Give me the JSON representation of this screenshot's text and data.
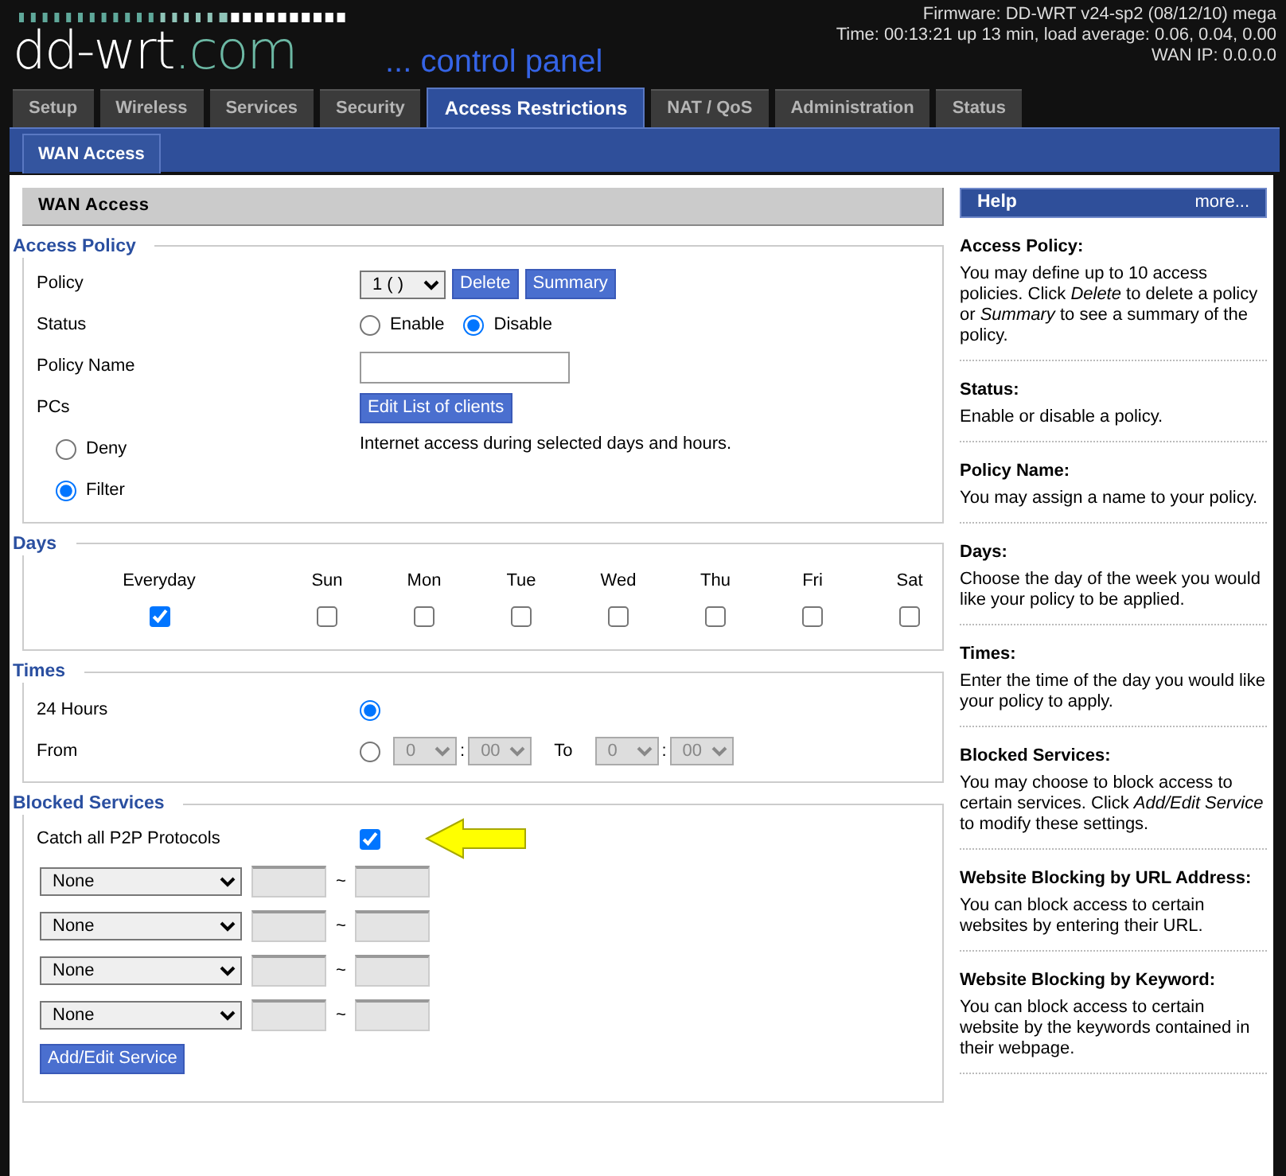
{
  "header": {
    "logo": {
      "main": "dd-wrt",
      "suffix": ".com"
    },
    "tagline": "... control panel",
    "info": [
      "Firmware: DD-WRT v24-sp2 (08/12/10) mega",
      "Time: 00:13:21 up 13 min, load average: 0.06, 0.04, 0.00",
      "WAN IP: 0.0.0.0"
    ]
  },
  "tabs": [
    {
      "label": "Setup",
      "selected": false
    },
    {
      "label": "Wireless",
      "selected": false
    },
    {
      "label": "Services",
      "selected": false
    },
    {
      "label": "Security",
      "selected": false
    },
    {
      "label": "Access Restrictions",
      "selected": true
    },
    {
      "label": "NAT / QoS",
      "selected": false
    },
    {
      "label": "Administration",
      "selected": false
    },
    {
      "label": "Status",
      "selected": false
    }
  ],
  "subtabs": [
    {
      "label": "WAN Access",
      "selected": true
    }
  ],
  "page_title": "WAN Access",
  "access_policy": {
    "legend": "Access Policy",
    "policy": {
      "label": "Policy",
      "value": "1 ( )",
      "buttons": [
        "Delete",
        "Summary"
      ]
    },
    "status": {
      "label": "Status",
      "options": [
        {
          "label": "Enable",
          "selected": false
        },
        {
          "label": "Disable",
          "selected": true
        }
      ]
    },
    "policy_name": {
      "label": "Policy Name"
    },
    "pcs": {
      "label": "PCs",
      "button": "Edit List of clients"
    },
    "modes": [
      {
        "label": "Deny",
        "selected": false
      },
      {
        "label": "Filter",
        "selected": true
      }
    ],
    "note": "Internet access during selected days and hours."
  },
  "days": {
    "legend": "Days",
    "items": [
      {
        "label": "Everyday",
        "checked": true
      },
      {
        "label": "Sun",
        "checked": false
      },
      {
        "label": "Mon",
        "checked": false
      },
      {
        "label": "Tue",
        "checked": false
      },
      {
        "label": "Wed",
        "checked": false
      },
      {
        "label": "Thu",
        "checked": false
      },
      {
        "label": "Fri",
        "checked": false
      },
      {
        "label": "Sat",
        "checked": false
      }
    ]
  },
  "times": {
    "legend": "Times",
    "all_day": {
      "label": "24 Hours",
      "selected": true
    },
    "range": {
      "label": "From",
      "selected": false,
      "from": {
        "hour": "0",
        "sep": ":",
        "minute": "00"
      },
      "to_label": "To",
      "to": {
        "hour": "0",
        "sep": ":",
        "minute": "00"
      }
    }
  },
  "blocked_services": {
    "legend": "Blocked Services",
    "p2p": {
      "label": "Catch all P2P Protocols",
      "checked": true
    },
    "services": [
      {
        "value": "None",
        "sep": "~"
      },
      {
        "value": "None",
        "sep": "~"
      },
      {
        "value": "None",
        "sep": "~"
      },
      {
        "value": "None",
        "sep": "~"
      }
    ],
    "button": "Add/Edit Service"
  },
  "help": {
    "title": "Help",
    "more": "more...",
    "items": [
      {
        "title": "Access Policy:",
        "text": "You may define up to 10 access policies. Click *Delete* to delete a policy or *Summary* to see a summary of the policy."
      },
      {
        "title": "Status:",
        "text": "Enable or disable a policy."
      },
      {
        "title": "Policy Name:",
        "text": "You may assign a name to your policy."
      },
      {
        "title": "Days:",
        "text": "Choose the day of the week you would like your policy to be applied."
      },
      {
        "title": "Times:",
        "text": "Enter the time of the day you would like your policy to apply."
      },
      {
        "title": "Blocked Services:",
        "text": "You may choose to block access to certain services. Click *Add/Edit Service* to modify these settings."
      },
      {
        "title": "Website Blocking by URL Address:",
        "text": "You can block access to certain websites by entering their URL."
      },
      {
        "title": "Website Blocking by Keyword:",
        "text": "You can block access to certain website by the keywords contained in their webpage."
      }
    ]
  }
}
